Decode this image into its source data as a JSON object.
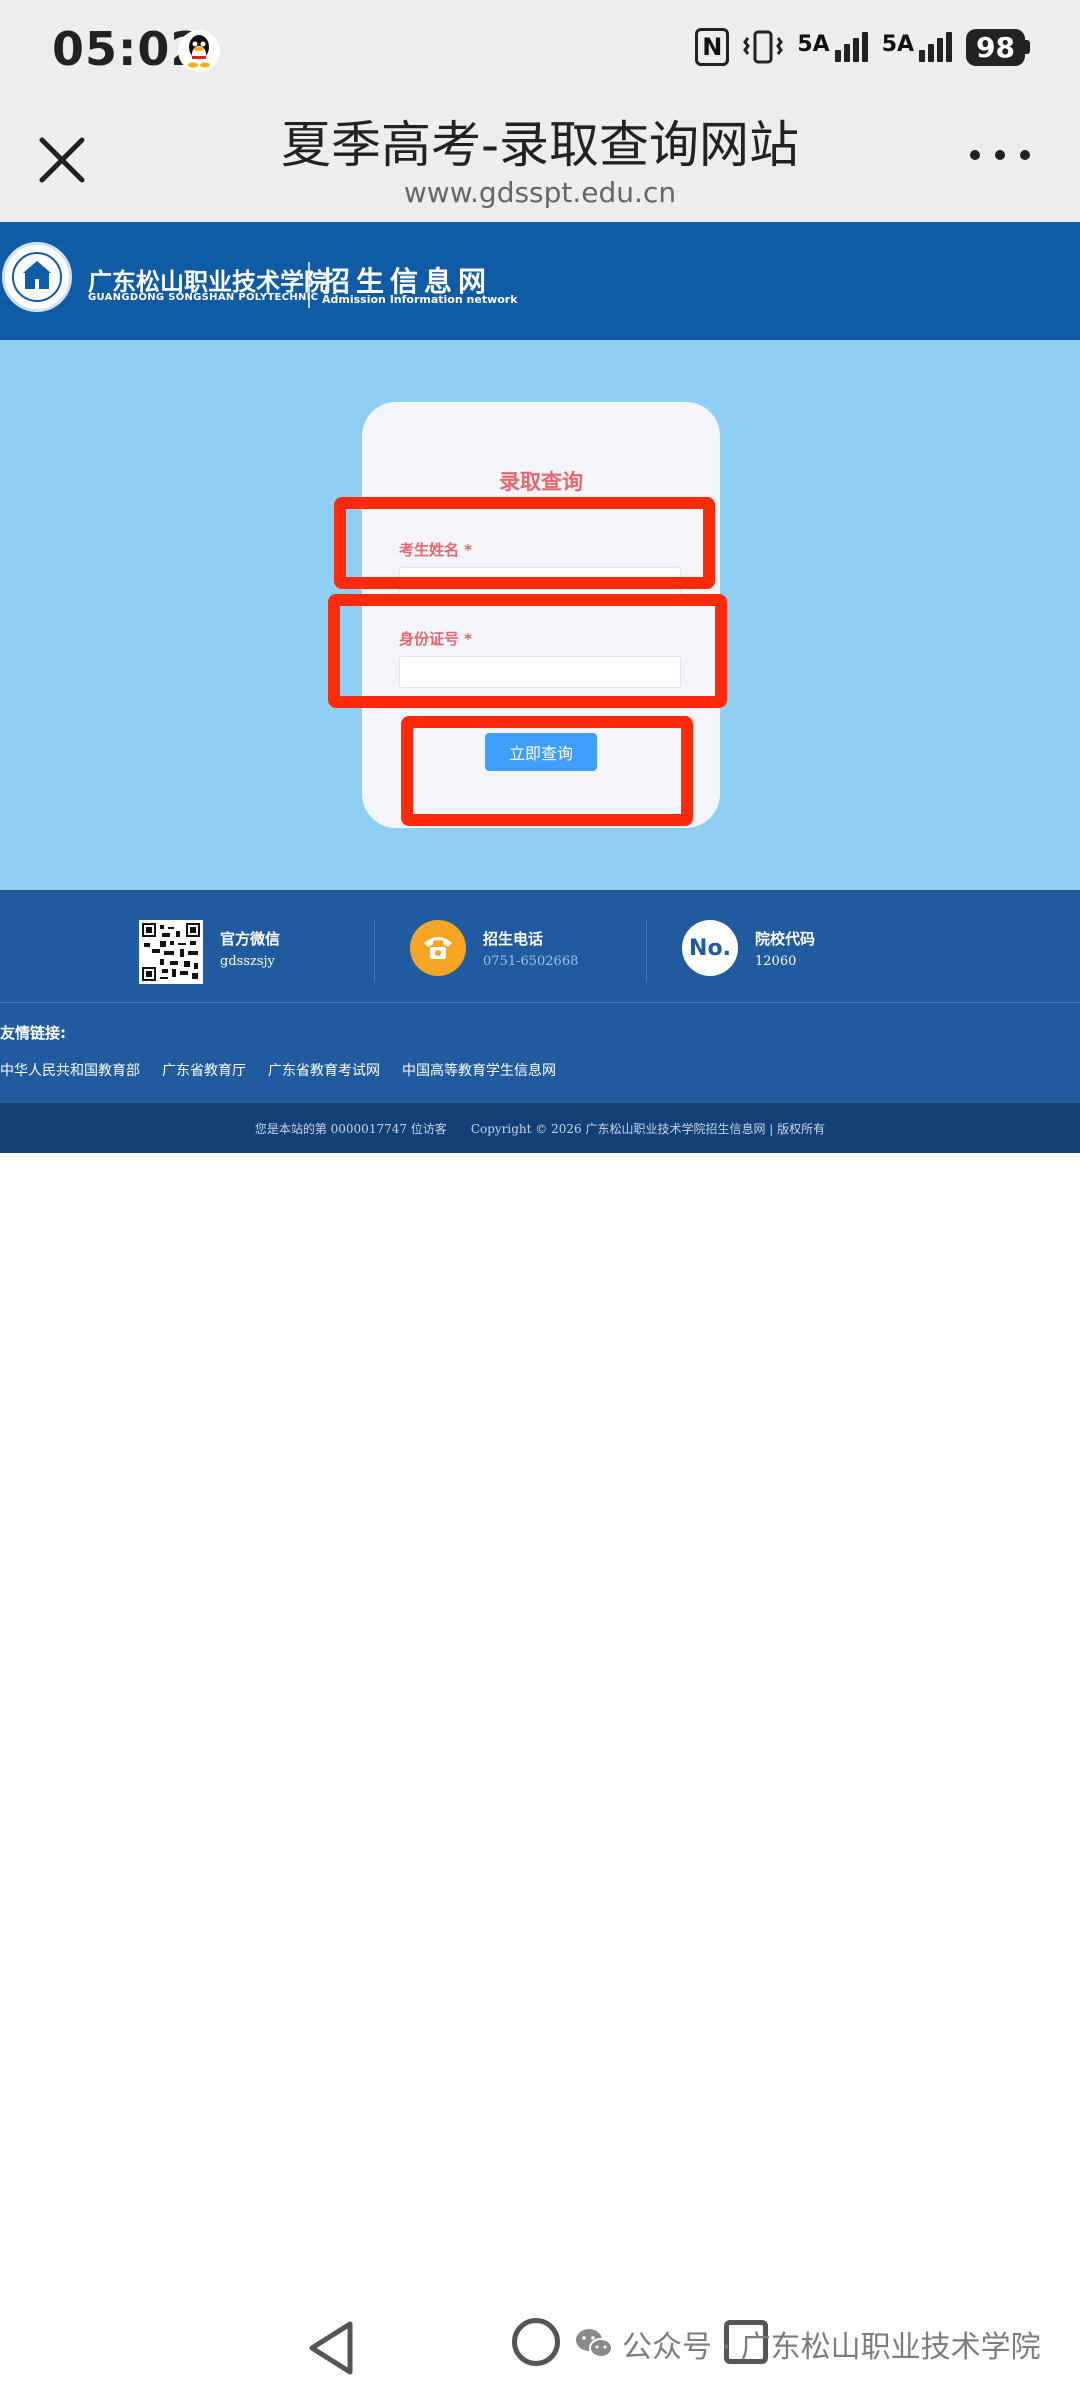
{
  "status_bar": {
    "time": "05:02",
    "network1_label": "5A",
    "network2_label": "5A",
    "battery": "98",
    "icons": [
      "qq-icon",
      "nfc-icon",
      "vibrate-icon",
      "signal-icon",
      "signal-icon",
      "battery-icon"
    ]
  },
  "browser": {
    "title": "夏季高考-录取查询网站",
    "url": "www.gdsspt.edu.cn"
  },
  "banner": {
    "school_cn": "广东松山职业技术学院",
    "school_en": "GUANGDONG SONGSHAN POLYTECHNIC",
    "site_cn": "招生信息网",
    "site_en": "Admission Information network"
  },
  "form": {
    "title": "录取查询",
    "name_label": "考生姓名",
    "id_label": "身份证号",
    "required_mark": "*",
    "name_value": "",
    "id_value": "",
    "submit_label": "立即查询",
    "highlight_color": "#ff2a0a"
  },
  "footer": {
    "wechat_title": "官方微信",
    "wechat_id": "gdsszsjy",
    "phone_title": "招生电话",
    "phone_number": "0751-6502668",
    "code_badge": "No.",
    "code_title": "院校代码",
    "code_value": "12060",
    "links_title": "友情链接:",
    "links": [
      "中华人民共和国教育部",
      "广东省教育厅",
      "广东省教育考试网",
      "中国高等教育学生信息网"
    ],
    "visitors": "您是本站的第 0000017747 位访客",
    "copyright": "Copyright © 2026 广东松山职业技术学院招生信息网 | 版权所有"
  },
  "watermark": {
    "text": "公众号 · 广东松山职业技术学院"
  }
}
